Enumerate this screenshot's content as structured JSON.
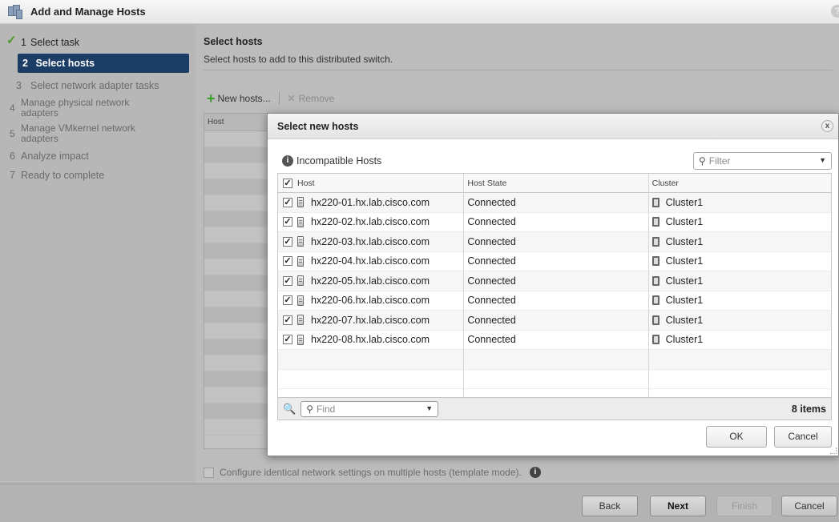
{
  "window": {
    "title": "Add and Manage Hosts",
    "help_glyph": "?"
  },
  "sidebar": {
    "steps": [
      {
        "num": "1",
        "label": "Select task",
        "state": "done"
      },
      {
        "num": "2",
        "label": "Select hosts",
        "state": "active"
      },
      {
        "num": "3",
        "label": "Select network adapter tasks",
        "state": "pending"
      },
      {
        "num": "4",
        "label": "Manage physical network adapters",
        "state": "pending"
      },
      {
        "num": "5",
        "label": "Manage VMkernel network adapters",
        "state": "pending"
      },
      {
        "num": "6",
        "label": "Analyze impact",
        "state": "pending"
      },
      {
        "num": "7",
        "label": "Ready to complete",
        "state": "pending"
      }
    ]
  },
  "main": {
    "title": "Select hosts",
    "subtitle": "Select hosts to add to this distributed switch.",
    "toolbar": {
      "new_hosts": "New hosts...",
      "remove": "Remove"
    },
    "grid_header": "Host",
    "template_label": "Configure identical network settings on multiple hosts (template mode)."
  },
  "dialog": {
    "title": "Select new hosts",
    "close_glyph": "x",
    "incompatible_label": "Incompatible Hosts",
    "filter_placeholder": "Filter",
    "columns": [
      "Host",
      "Host State",
      "Cluster"
    ],
    "rows": [
      {
        "host": "hx220-01.hx.lab.cisco.com",
        "state": "Connected",
        "cluster": "Cluster1",
        "checked": true
      },
      {
        "host": "hx220-02.hx.lab.cisco.com",
        "state": "Connected",
        "cluster": "Cluster1",
        "checked": true
      },
      {
        "host": "hx220-03.hx.lab.cisco.com",
        "state": "Connected",
        "cluster": "Cluster1",
        "checked": true
      },
      {
        "host": "hx220-04.hx.lab.cisco.com",
        "state": "Connected",
        "cluster": "Cluster1",
        "checked": true
      },
      {
        "host": "hx220-05.hx.lab.cisco.com",
        "state": "Connected",
        "cluster": "Cluster1",
        "checked": true
      },
      {
        "host": "hx220-06.hx.lab.cisco.com",
        "state": "Connected",
        "cluster": "Cluster1",
        "checked": true
      },
      {
        "host": "hx220-07.hx.lab.cisco.com",
        "state": "Connected",
        "cluster": "Cluster1",
        "checked": true
      },
      {
        "host": "hx220-08.hx.lab.cisco.com",
        "state": "Connected",
        "cluster": "Cluster1",
        "checked": true
      }
    ],
    "find_placeholder": "Find",
    "item_count": "8 items",
    "ok_label": "OK",
    "cancel_label": "Cancel"
  },
  "footer": {
    "back": "Back",
    "next": "Next",
    "finish": "Finish",
    "cancel": "Cancel"
  },
  "colors": {
    "active_step_bg": "#1c3d66",
    "check_green": "#4a9a2a",
    "add_green": "#3b9b2c"
  }
}
